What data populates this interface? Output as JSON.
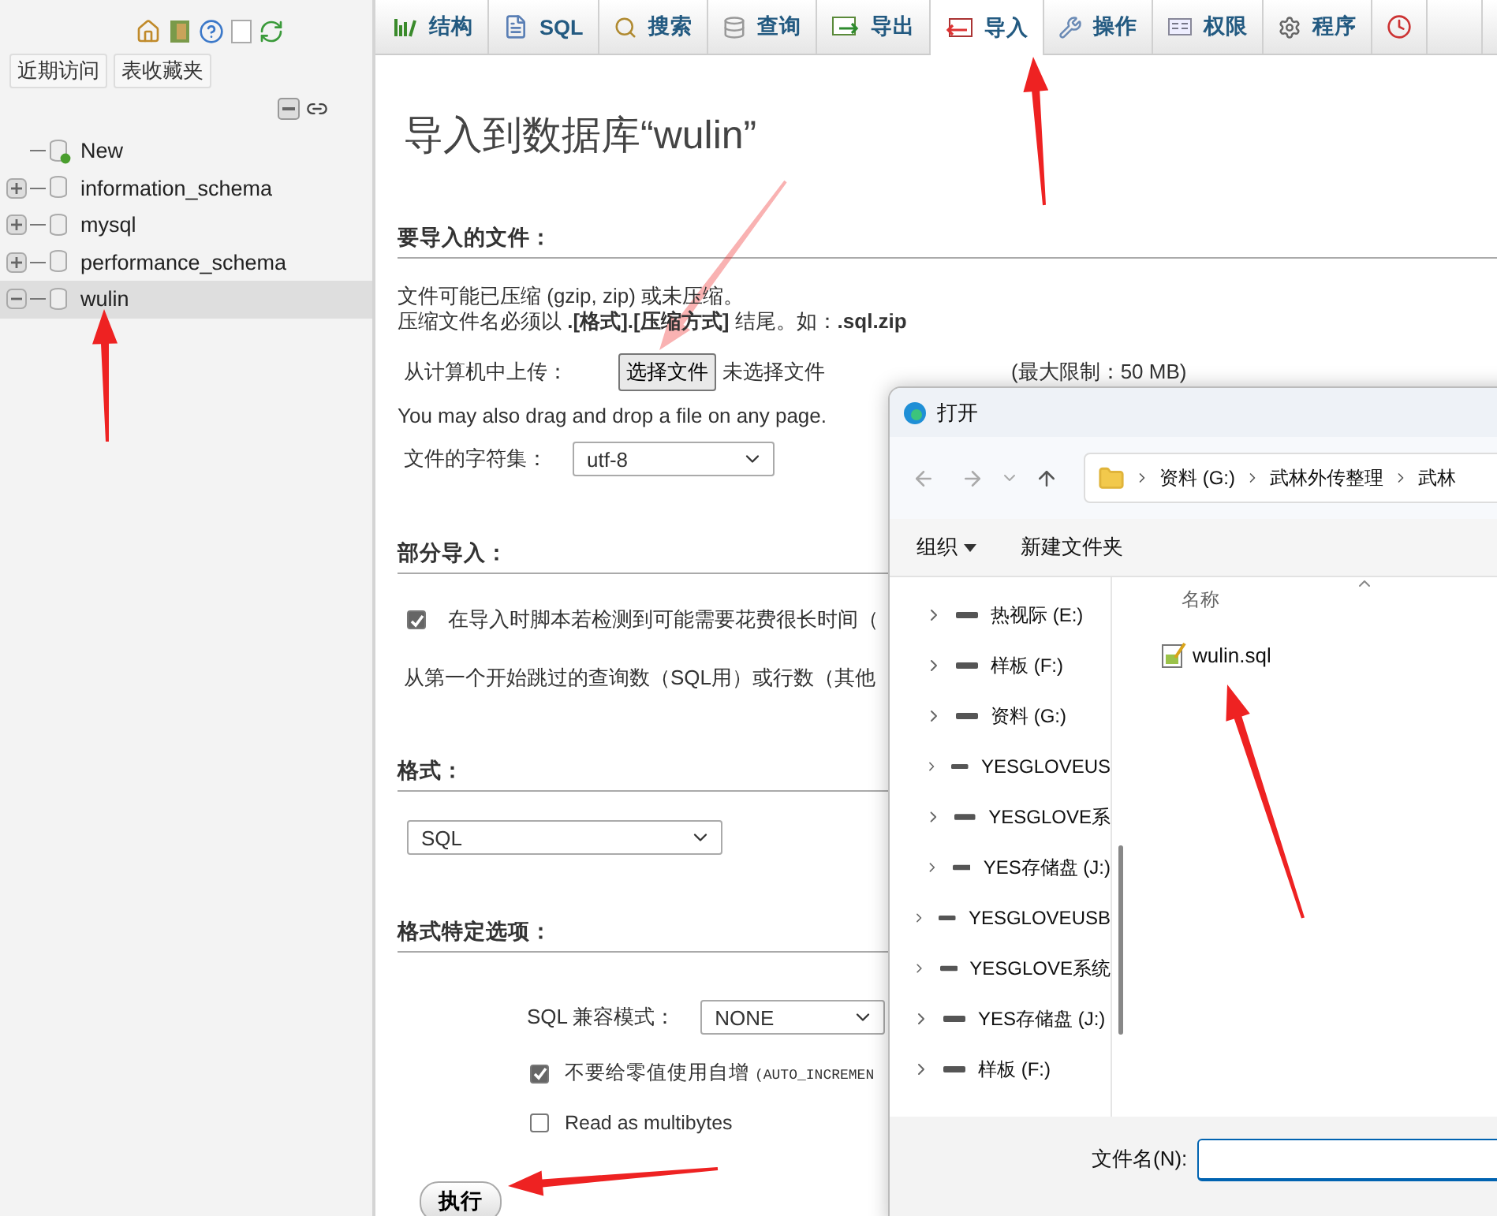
{
  "sidebar": {
    "buttons": [
      "近期访问",
      "表收藏夹"
    ],
    "tree": [
      {
        "label": "New",
        "kind": "new",
        "selected": false
      },
      {
        "label": "information_schema",
        "kind": "database",
        "expanded": false,
        "selected": false
      },
      {
        "label": "mysql",
        "kind": "database",
        "expanded": false,
        "selected": false
      },
      {
        "label": "performance_schema",
        "kind": "database",
        "expanded": false,
        "selected": false
      },
      {
        "label": "wulin",
        "kind": "database",
        "expanded": true,
        "selected": true
      }
    ]
  },
  "tabs": [
    {
      "label": "结构",
      "kind": "structure",
      "selected": false
    },
    {
      "label": "SQL",
      "kind": "sql",
      "selected": false
    },
    {
      "label": "搜索",
      "kind": "search",
      "selected": false
    },
    {
      "label": "查询",
      "kind": "query",
      "selected": false
    },
    {
      "label": "导出",
      "kind": "export",
      "selected": false
    },
    {
      "label": "导入",
      "kind": "import",
      "selected": true
    },
    {
      "label": "操作",
      "kind": "operations",
      "selected": false
    },
    {
      "label": "权限",
      "kind": "privileges",
      "selected": false
    },
    {
      "label": "程序",
      "kind": "routines",
      "selected": false
    }
  ],
  "page": {
    "title": "导入到数据库“wulin”",
    "file_section": {
      "heading": "要导入的文件：",
      "note_lines": [
        "文件可能已压缩 (gzip, zip) 或未压缩。",
        "压缩文件名必须以 **.[格式].[压缩方式]** 结尾。如：**.sql.zip**"
      ],
      "upload_label": "从计算机中上传：",
      "choose_button": "选择文件",
      "no_file": "未选择文件",
      "max_size": "(最大限制：50 MB)",
      "drag_note": "You may also drag and drop a file on any page.",
      "charset_label": "文件的字符集：",
      "charset_value": "utf-8"
    },
    "partial_section": {
      "heading": "部分导入：",
      "interrupt": {
        "label": "在导入时脚本若检测到可能需要花费很长时间（",
        "checked": true
      },
      "skip_label": "从第一个开始跳过的查询数（SQL用）或行数（其他"
    },
    "format_section": {
      "heading": "格式：",
      "value": "SQL"
    },
    "options_section": {
      "heading": "格式特定选项：",
      "compat_label": "SQL 兼容模式：",
      "compat_value": "NONE",
      "options": [
        {
          "label": "不要给零值使用自增",
          "code": "(AUTO_INCREMEN",
          "checked": true
        },
        {
          "label": "Read as multibytes",
          "checked": false
        }
      ]
    },
    "submit": "执行"
  },
  "dialog": {
    "title": "打开",
    "breadcrumb": [
      "资料 (G:)",
      "武林外传整理",
      "武林"
    ],
    "toolbar": {
      "organize": "组织",
      "new_folder": "新建文件夹"
    },
    "nav_subitems": [
      {
        "label": "热视际 (E:)"
      },
      {
        "label": "样板 (F:)"
      },
      {
        "label": "资料 (G:)"
      },
      {
        "label": "YESGLOVEUS"
      },
      {
        "label": "YESGLOVE系"
      },
      {
        "label": "YES存储盘 (J:)"
      }
    ],
    "nav_items": [
      {
        "label": "YESGLOVEUSB"
      },
      {
        "label": "YESGLOVE系统"
      },
      {
        "label": "YES存储盘 (J:)"
      },
      {
        "label": "样板 (F:)"
      }
    ],
    "column": "名称",
    "files": [
      {
        "name": "wulin.sql"
      }
    ],
    "filename_label": "文件名(N):"
  }
}
